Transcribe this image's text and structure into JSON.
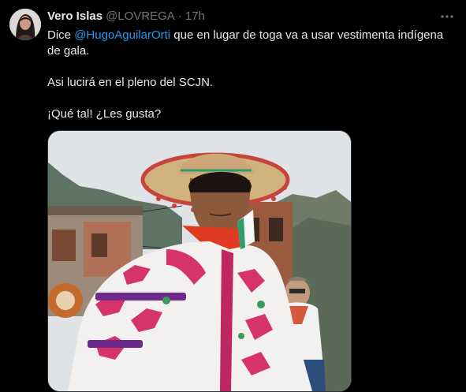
{
  "tweet": {
    "display_name": "Vero Islas",
    "handle": "@LOVREGA",
    "separator": "·",
    "time": "17h",
    "text": {
      "line1_prefix": "Dice ",
      "mention": "@HugoAguilarOrti",
      "line1_suffix": " que en lugar de toga va a usar vestimenta indígena de gala.",
      "line2": "Asi lucirá en el pleno del SCJN.",
      "line3": "¡Qué tal! ¿Les gusta?"
    },
    "icons": {
      "more": "more-horizontal-icon",
      "avatar": "avatar"
    }
  },
  "colors": {
    "background": "#000000",
    "text": "#e7e9ea",
    "secondary": "#71767b",
    "link": "#1d9bf0"
  }
}
